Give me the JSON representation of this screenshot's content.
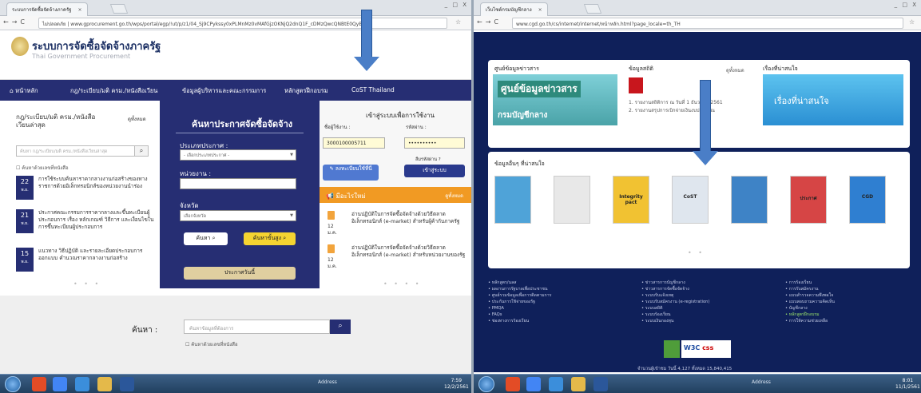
{
  "left_browser": {
    "tab_title": "ระบบการจัดซื้อจัดจ้างภาครัฐ",
    "url_prefix": "ไม่ปลอดภัย",
    "url": "www.gprocurement.go.th/wps/portal/egp/!ut/p/z1/04_Sj9CPykssy0xPLMnMz0vMAfGjzOKNjQ2dnQ1F_cDMzQwcQNBtE0QyBh",
    "window_controls": "_ □ X"
  },
  "gp_site": {
    "title": "ระบบการจัดซื้อจัดจ้างภาครัฐ",
    "subtitle": "Thai Government Procurement",
    "menu": [
      "หน้าหลัก",
      "กฎ/ระเบียบ/มติ ครม./หนังสือเวียน",
      "ข้อมูลผู้บริหารและคณะกรรมการ",
      "หลักสูตรฝึกอบรม",
      "CoST Thailand"
    ],
    "left_col": {
      "heading": "กฎ/ระเบียบ/มติ ครม./หนังสือเวียนล่าสุด",
      "see_all": "ดูทั้งหมด",
      "search_placeholder": "ค้นหา กฎ/ระเบียบ/มติ ครม./หนังสือเวียนล่าสุด",
      "checkbox_label": "ค้นหาด้วยเลขที่หนังสือ",
      "news": [
        {
          "day": "22",
          "month": "พ.ย.",
          "text": "การใช้ระบบค้นหาราคากลางงานก่อสร้างของทางราชการด้วยอิเล็กทรอนิกส์ของหน่วยงานนำร่อง"
        },
        {
          "day": "21",
          "month": "พ.ย.",
          "text": "ประกาศคณะกรรมการราคากลางและขึ้นทะเบียนผู้ประกอบการ เรื่อง หลักเกณฑ์ วิธีการ และเงื่อนไขในการขึ้นทะเบียนผู้ประกอบการ"
        },
        {
          "day": "15",
          "month": "พ.ย.",
          "text": "แนวทาง วิธีปฏิบัติ และรายละเอียดประกอบการออกแบบ คำนวณราคากลางงานก่อสร้าง"
        }
      ]
    },
    "search_panel": {
      "title": "ค้นหาประกาศจัดซื้อจัดจ้าง",
      "type_label": "ประเภทประกาศ :",
      "type_value": "- เลือกประเภทประกาศ -",
      "agency_label": "หน่วยงาน :",
      "province_label": "จังหวัด",
      "province_value": "เลือกจังหวัด",
      "search_btn": "ค้นหา",
      "advanced_btn": "ค้นหาขั้นสูง",
      "all_btn": "ประกาศวันนี้"
    },
    "login": {
      "title": "เข้าสู่ระบบเพื่อการใช้งาน",
      "user_label": "ชื่อผู้ใช้งาน :",
      "user_value": "3000100005711",
      "pass_label": "รหัสผ่าน :",
      "pass_value": "••••••••••",
      "forgot": "ลืมรหัสผ่าน ?",
      "register_btn": "ลงทะเบียนใช้ที่นี่",
      "login_btn": "เข้าสู่ระบบ"
    },
    "announcements": {
      "title": "มีอะไรใหม่",
      "see_all": "ดูทั้งหมด",
      "items": [
        {
          "day": "12",
          "month": "ม.ค.",
          "text": "อ่านปฏิบัติในการจัดซื้อจัดจ้างด้วยวิธีตลาดอิเล็กทรอนิกส์ (e-market) สำหรับผู้ค้ากับภาครัฐ"
        },
        {
          "day": "12",
          "month": "ม.ค.",
          "text": "อ่านปฏิบัติในการจัดซื้อจัดจ้างด้วยวิธีตลาดอิเล็กทรอนิกส์ (e-market) สำหรับหน่วยงานของรัฐ"
        }
      ]
    },
    "bottom_search": {
      "label": "ค้นหา :",
      "placeholder": "ค้นหาข้อมูลที่ต้องการ",
      "checkbox_label": "ค้นหาด้วยเลขที่หนังสือ"
    }
  },
  "right_browser": {
    "tab_title": "เว็บไซต์กรมบัญชีกลาง",
    "url": "www.cgd.go.th/cs/internet/internet/หน้าหลัก.html?page_locale=th_TH",
    "window_controls": "_ □ X"
  },
  "cgd_site": {
    "info_center": "ศูนย์ข้อมูลข่าวสาร",
    "banner_text": "ศูนย์ข้อมูลข่าวสาร",
    "banner_sub": "กรมบัญชีกลาง",
    "stats_title": "ข้อมูลสถิติ",
    "stats_items": [
      "1. รายงานสถิติการ ณ วันที่ 1 ธันวาคม 2561",
      "2. รายงานสรุปการเบิกจ่ายเงินงบประมาณ"
    ],
    "stats_see_all": "ดูทั้งหมด",
    "interesting_title": "เรื่องที่น่าสนใจ",
    "interesting_banner": "เรื่องที่น่าสนใจ",
    "pubs_title": "ข้อมูลอื่นๆ ที่น่าสนใจ",
    "book_labels": [
      "",
      "",
      "Integrity pact",
      "CoST",
      "",
      "ประกาศ",
      "CGD"
    ],
    "book_colors": [
      "#4fa3d8",
      "#e8e8e8",
      "#f1c232",
      "#dfe6ee",
      "#3e83c6",
      "#d64545",
      "#2f7fd1"
    ],
    "footer_col1": [
      "หลักสูตร/นลส",
      "ผลงานการรัฐบาลเพื่อประชาชน",
      "ศูนย์รวมข้อมูลเพื่อการติดตามการ",
      "ประกันการใช้จ่ายของรัฐ",
      "PMQA",
      "FAQs",
      "ช่องทางการร้องเรียน"
    ],
    "footer_col2": [
      "ข่าวสารการบัญชีกลาง",
      "ข่าวสารการจัดซื้อจัดจ้าง",
      "ระบบรับแจ้งเหตุ",
      "ระบบรับสมัครงาน (e-registration)",
      "ระบบสถิติ",
      "ระบบร้องเรียน",
      "ระบบเงินกองทุน"
    ],
    "footer_col3": [
      "การร้องเรียน",
      "การรับสมัครงาน",
      "แบบสำรวจความพึงพอใจ",
      "แบบสอบถามความคิดเห็น",
      "บัญชีกลาง",
      "หลักสูตรฝึกอบรม",
      "การให้ความช่วยเหลือ"
    ],
    "logo_w3c": "W3C",
    "logo_css": "css",
    "counter": "จำนวนผู้เข้าชม วันนี้ 4,127 ทั้งหมด 15,840,415"
  },
  "taskbar": {
    "address_label": "Address",
    "left_time": "7:59",
    "left_date": "12/2/2561",
    "right_time": "8:01",
    "right_date": "11/1/2561"
  }
}
